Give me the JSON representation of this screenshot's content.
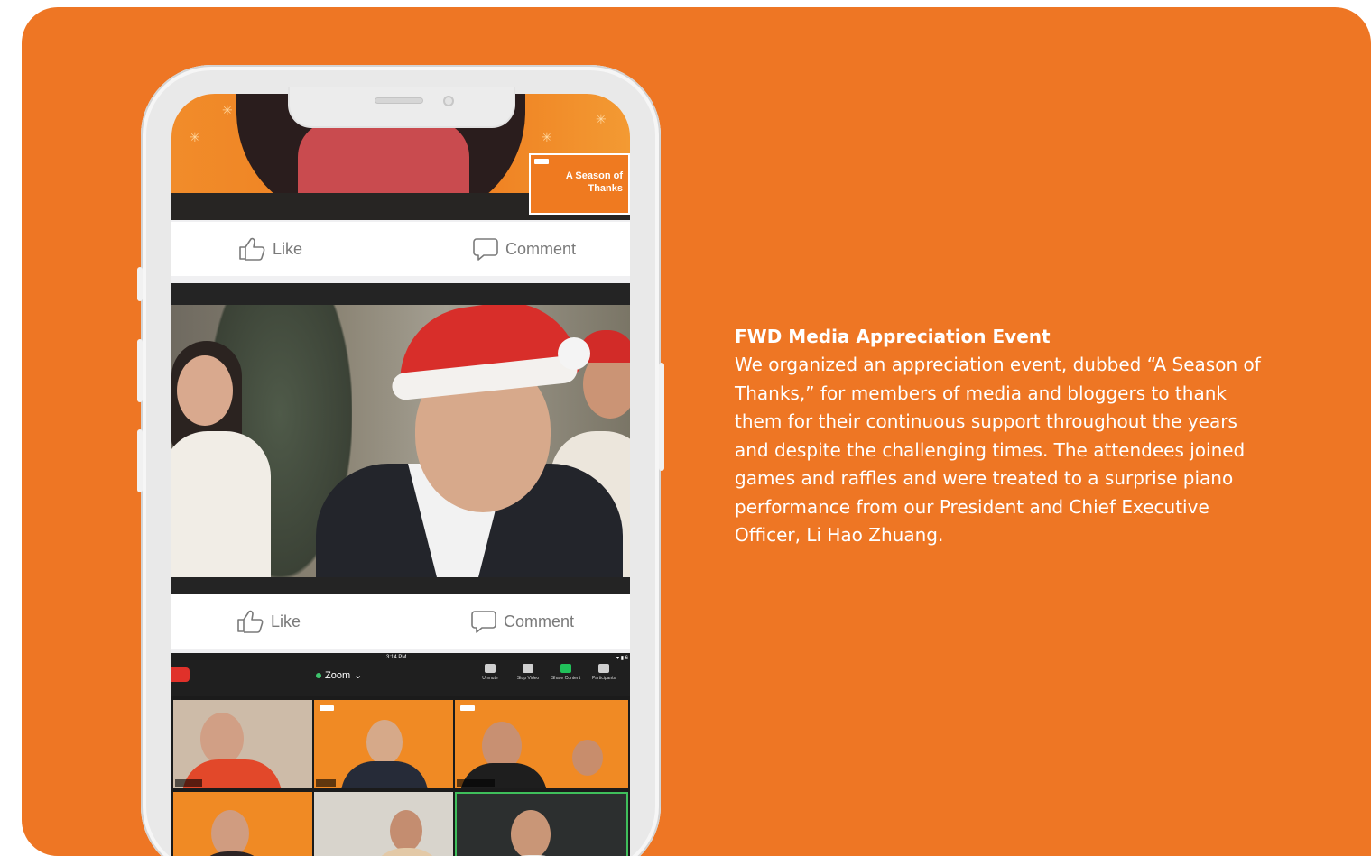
{
  "article": {
    "title": "FWD Media Appreciation Event",
    "body": "We organized an appreciation event, dubbed “A Season of Thanks,” for members of media and bloggers to thank them for their continuous support throughout the years and despite the challenging times. The attendees joined games and raffles and were treated to a surprise piano performance from our President and Chief Executive Officer, Li Hao Zhuang."
  },
  "phone": {
    "post1": {
      "sticker_text": "A Season of Thanks",
      "like_label": "Like",
      "comment_label": "Comment"
    },
    "post2": {
      "like_label": "Like",
      "comment_label": "Comment"
    },
    "zoom": {
      "time": "3:14 PM",
      "app_name": "Zoom",
      "tools": [
        "Unmute",
        "Stop Video",
        "Share Content",
        "Participants"
      ]
    }
  },
  "colors": {
    "brand_orange": "#ee7624",
    "white": "#ffffff"
  }
}
